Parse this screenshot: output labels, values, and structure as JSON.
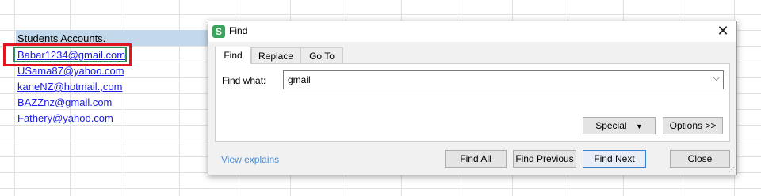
{
  "sheet": {
    "title_cell": "Students Accounts.",
    "emails": [
      "Babar1234@gmail.com",
      "USama87@yahoo.com",
      "kaneNZ@hotmail.,com",
      "BAZZnz@gmail.com",
      "Fathery@yahoo.com"
    ]
  },
  "dialog": {
    "app_icon": "S",
    "title": "Find",
    "close_icon": "✕",
    "tabs": [
      "Find",
      "Replace",
      "Go To"
    ],
    "active_tab": "Find",
    "find_label": "Find what:",
    "find_value": "gmail",
    "dropdown_arrow": "⌵",
    "special_label": "Special",
    "special_arrow": "▼",
    "options_label": "Options >>",
    "view_explains": "View explains",
    "buttons": {
      "find_all": "Find All",
      "find_previous": "Find Previous",
      "find_next": "Find Next",
      "close": "Close"
    }
  },
  "colors": {
    "header_fill": "#c4d8ec",
    "link": "#1a1ae6",
    "annotation_box": "#e0141e",
    "active_cell": "#2e8b57",
    "app_icon": "#3aa55c"
  }
}
